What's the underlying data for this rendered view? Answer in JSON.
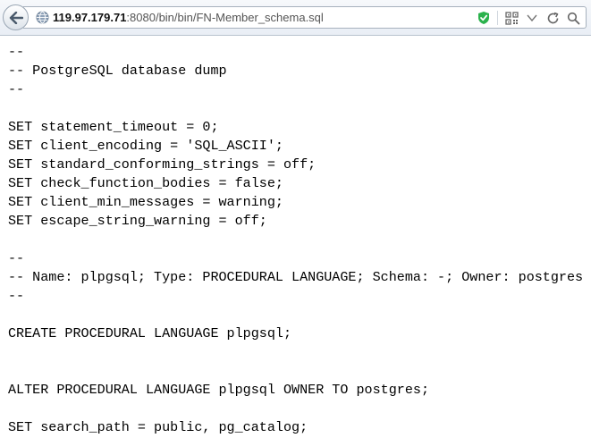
{
  "toolbar": {
    "url_host": "119.97.179.71",
    "url_rest": ":8080/bin/bin/FN-Member_schema.sql",
    "icons": [
      "back-arrow-icon",
      "globe-icon",
      "shield-check-icon",
      "qr-code-icon",
      "dropdown-arrow-icon",
      "reload-icon",
      "search-icon"
    ],
    "colors": {
      "shield": "#2bb24c",
      "back_arrow": "#4a5a6c"
    }
  },
  "document": {
    "lines": [
      "--",
      "-- PostgreSQL database dump",
      "--",
      "",
      "SET statement_timeout = 0;",
      "SET client_encoding = 'SQL_ASCII';",
      "SET standard_conforming_strings = off;",
      "SET check_function_bodies = false;",
      "SET client_min_messages = warning;",
      "SET escape_string_warning = off;",
      "",
      "--",
      "-- Name: plpgsql; Type: PROCEDURAL LANGUAGE; Schema: -; Owner: postgres",
      "--",
      "",
      "CREATE PROCEDURAL LANGUAGE plpgsql;",
      "",
      "",
      "ALTER PROCEDURAL LANGUAGE plpgsql OWNER TO postgres;",
      "",
      "SET search_path = public, pg_catalog;"
    ]
  }
}
